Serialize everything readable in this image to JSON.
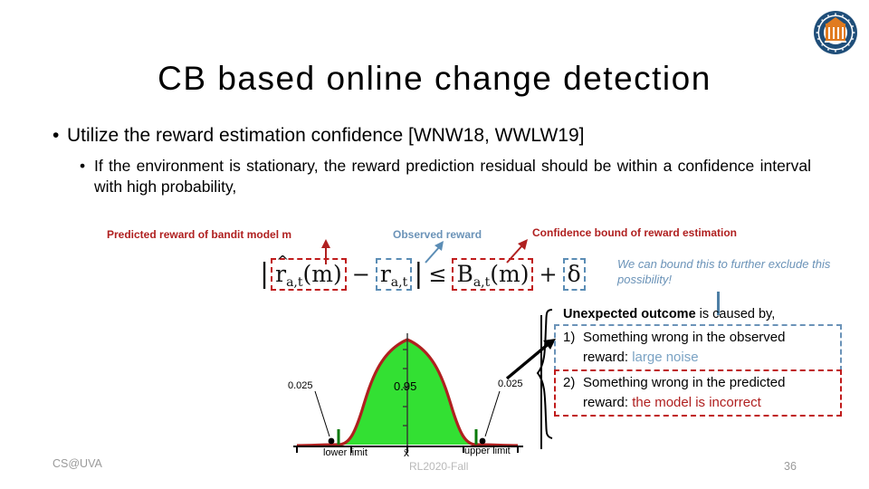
{
  "slide": {
    "title": "CB  based  online  change  detection",
    "footer_left": "CS@UVA",
    "page_number": "36",
    "watermark": "RL2020-Fall",
    "logo_name": "uva-seal"
  },
  "bullets": {
    "level1": "Utilize the reward  estimation confidence [WNW18,  WWLW19]",
    "level2": "If  the  environment is  stationary,  the  reward  prediction  residual  should  be  within  a  confidence  interval  with  high probability,"
  },
  "annotations": {
    "predicted_reward": "Predicted  reward of bandit model m",
    "observed_reward": "Observed  reward",
    "confidence_bound": "Confidence bound of reward estimation",
    "we_can_bound": "We can bound this to further exclude this possibility!"
  },
  "formula": {
    "predicted_term": "r",
    "predicted_hat": "^",
    "predicted_sub": "a,t",
    "predicted_arg": "(m)",
    "observed_term": "r",
    "observed_sub": "a,t",
    "minus": "−",
    "leq": "≤",
    "bound_term": "B",
    "bound_sub": "a,t",
    "bound_arg": "(m)",
    "plus": "+",
    "delta": "δ",
    "abs_bar": "|"
  },
  "outcome": {
    "heading_bold": "Unexpected outcome",
    "heading_rest": " is caused by,",
    "items": [
      {
        "number": "1)",
        "text": "Something  wrong  in  the observed  reward: ",
        "highlight": "large noise",
        "highlight_color": "#7ba3c4"
      },
      {
        "number": "2)",
        "text": "Something  wrong  in the predicted  reward: ",
        "highlight": "the model is incorrect",
        "highlight_color": "#b02020"
      }
    ]
  },
  "chart_data": {
    "type": "area",
    "title": "Normal distribution confidence interval",
    "xlabel": "",
    "ylabel": "",
    "annotations": [
      {
        "label": "0.025",
        "position": "left-tail"
      },
      {
        "label": "0.95",
        "position": "center"
      },
      {
        "label": "0.025",
        "position": "right-tail"
      }
    ],
    "tick_labels": [
      "lower limit",
      "x̄",
      "upper limit"
    ],
    "left_tail_area": 0.025,
    "center_area": 0.95,
    "right_tail_area": 0.025,
    "curve_color": "#b0201f",
    "fill_color": "#33e033",
    "grid": false,
    "x": [
      -4,
      -3.5,
      -3,
      -2.5,
      -2,
      -1.96,
      -1.5,
      -1,
      -0.5,
      0,
      0.5,
      1,
      1.5,
      1.96,
      2,
      2.5,
      3,
      3.5,
      4
    ],
    "y": [
      0.0001,
      0.0009,
      0.0044,
      0.0175,
      0.054,
      0.0584,
      0.1295,
      0.242,
      0.3521,
      0.3989,
      0.3521,
      0.242,
      0.1295,
      0.0584,
      0.054,
      0.0175,
      0.0044,
      0.0009,
      0.0001
    ]
  },
  "colors": {
    "red": "#b02020",
    "dashed_red": "#c01b1b",
    "blue": "#6b93b8",
    "dashed_blue": "#5b8db5",
    "green_fill": "#33e033",
    "curve_red": "#b0201f",
    "footer_gray": "#9a9a9a"
  }
}
